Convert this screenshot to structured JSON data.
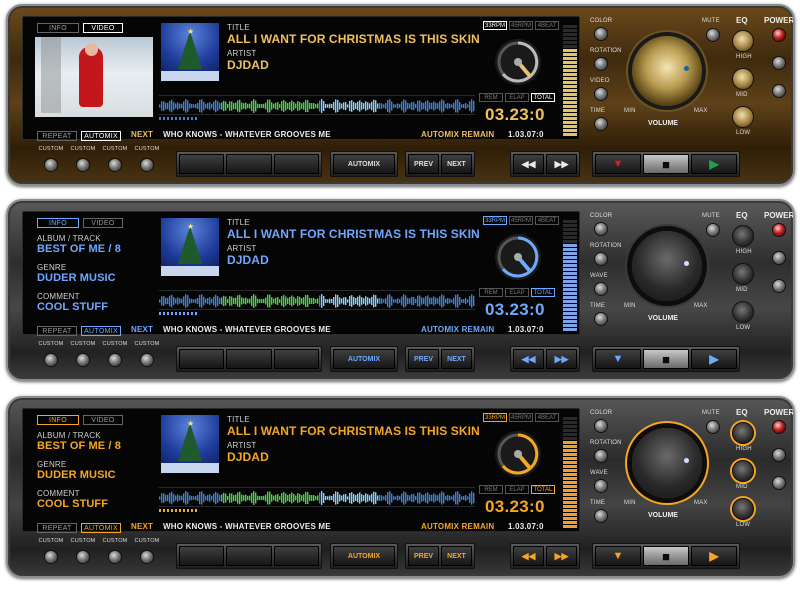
{
  "players": [
    {
      "skin": "gold",
      "accent": "#f0c060",
      "tabs": {
        "info": "INFO",
        "video": "VIDEO",
        "active": "video"
      },
      "title_label": "TITLE",
      "title": "ALL I WANT FOR CHRISTMAS IS THIS SKIN",
      "artist_label": "ARTIST",
      "artist": "DJDAD",
      "album_label": "",
      "album": "",
      "genre_label": "",
      "genre": "",
      "comment_label": "",
      "comment": "",
      "rpm": [
        "33RPM",
        "45RPM",
        "4BEAT"
      ],
      "time_modes": [
        "REM",
        "ELAP",
        "TOTAL"
      ],
      "time": "03.23:0",
      "repeat": "REPEAT",
      "automix_toggle": "AUTOMIX",
      "next_label": "NEXT",
      "next_track": "WHO KNOWS - WHATEVER GROOVES ME",
      "remain_label": "AUTOMIX REMAIN",
      "remain_time": "1.03.07:0",
      "side_labels": [
        "COLOR",
        "ROTATION",
        "VIDEO",
        "TIME"
      ],
      "mute": "MUTE",
      "eq": "EQ",
      "power": "POWER",
      "eq_bands": [
        "HIGH",
        "MID",
        "LOW"
      ],
      "volume": "VOLUME",
      "vol_min": "MIN",
      "vol_max": "MAX",
      "custom": [
        "CUSTOM",
        "CUSTOM",
        "CUSTOM",
        "CUSTOM"
      ],
      "automix_btn": "AUTOMIX",
      "prev_btn": "PREV",
      "next_btn": "NEXT",
      "transport": [
        "rewind-icon",
        "fast-forward-icon",
        "stop-icon",
        "play-icon"
      ],
      "transport_glyph": {
        "rew": "◀◀",
        "ff": "▶▶",
        "down": "▼",
        "stop": "■",
        "play": "▶"
      },
      "transport_colors": {
        "down": "#d02020",
        "stop": "#111111",
        "play": "#1fa04a"
      }
    },
    {
      "skin": "silver",
      "accent": "#6fa8ff",
      "tabs": {
        "info": "INFO",
        "video": "VIDEO",
        "active": "info"
      },
      "title_label": "TITLE",
      "title": "ALL I WANT FOR CHRISTMAS IS THIS SKIN",
      "artist_label": "ARTIST",
      "artist": "DJDAD",
      "album_label": "ALBUM / TRACK",
      "album": "BEST OF ME / 8",
      "genre_label": "GENRE",
      "genre": "DUDER MUSIC",
      "comment_label": "COMMENT",
      "comment": "COOL STUFF",
      "rpm": [
        "33RPM",
        "45RPM",
        "4BEAT"
      ],
      "time_modes": [
        "REM",
        "ELAP",
        "TOTAL"
      ],
      "time": "03.23:0",
      "repeat": "REPEAT",
      "automix_toggle": "AUTOMIX",
      "next_label": "NEXT",
      "next_track": "WHO KNOWS - WHATEVER GROOVES ME",
      "remain_label": "AUTOMIX REMAIN",
      "remain_time": "1.03.07:0",
      "side_labels": [
        "COLOR",
        "ROTATION",
        "WAVE",
        "TIME"
      ],
      "mute": "MUTE",
      "eq": "EQ",
      "power": "POWER",
      "eq_bands": [
        "HIGH",
        "MID",
        "LOW"
      ],
      "volume": "VOLUME",
      "vol_min": "MIN",
      "vol_max": "MAX",
      "custom": [
        "CUSTOM",
        "CUSTOM",
        "CUSTOM",
        "CUSTOM"
      ],
      "automix_btn": "AUTOMIX",
      "prev_btn": "PREV",
      "next_btn": "NEXT",
      "transport": [
        "rewind-icon",
        "fast-forward-icon",
        "stop-icon",
        "play-icon"
      ],
      "transport_glyph": {
        "rew": "◀◀",
        "ff": "▶▶",
        "down": "▼",
        "stop": "■",
        "play": "▶"
      },
      "transport_colors": {
        "down": "#6fa8ff",
        "stop": "#111111",
        "play": "#6fa8ff"
      }
    },
    {
      "skin": "orange",
      "accent": "#f5a623",
      "tabs": {
        "info": "INFO",
        "video": "VIDEO",
        "active": "info"
      },
      "title_label": "TITLE",
      "title": "ALL I WANT FOR CHRISTMAS IS THIS SKIN",
      "artist_label": "ARTIST",
      "artist": "DJDAD",
      "album_label": "ALBUM / TRACK",
      "album": "BEST OF ME / 8",
      "genre_label": "GENRE",
      "genre": "DUDER MUSIC",
      "comment_label": "COMMENT",
      "comment": "COOL STUFF",
      "rpm": [
        "33RPM",
        "45RPM",
        "4BEAT"
      ],
      "time_modes": [
        "REM",
        "ELAP",
        "TOTAL"
      ],
      "time": "03.23:0",
      "repeat": "REPEAT",
      "automix_toggle": "AUTOMIX",
      "next_label": "NEXT",
      "next_track": "WHO KNOWS - WHATEVER GROOVES ME",
      "remain_label": "AUTOMIX REMAIN",
      "remain_time": "1.03.07:0",
      "side_labels": [
        "COLOR",
        "ROTATION",
        "WAVE",
        "TIME"
      ],
      "mute": "MUTE",
      "eq": "EQ",
      "power": "POWER",
      "eq_bands": [
        "HIGH",
        "MID",
        "LOW"
      ],
      "volume": "VOLUME",
      "vol_min": "MIN",
      "vol_max": "MAX",
      "custom": [
        "CUSTOM",
        "CUSTOM",
        "CUSTOM",
        "CUSTOM"
      ],
      "automix_btn": "AUTOMIX",
      "prev_btn": "PREV",
      "next_btn": "NEXT",
      "transport": [
        "rewind-icon",
        "fast-forward-icon",
        "stop-icon",
        "play-icon"
      ],
      "transport_glyph": {
        "rew": "◀◀",
        "ff": "▶▶",
        "down": "▼",
        "stop": "■",
        "play": "▶"
      },
      "transport_colors": {
        "down": "#f5a623",
        "stop": "#111111",
        "play": "#f5a623"
      }
    }
  ]
}
